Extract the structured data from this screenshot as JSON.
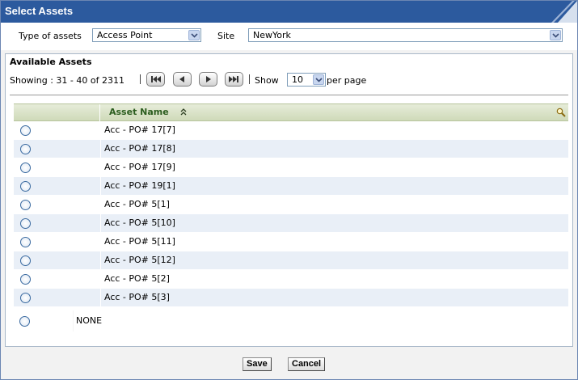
{
  "window": {
    "title": "Select Assets"
  },
  "filters": {
    "type_label": "Type of assets",
    "type_value": "Access Point",
    "site_label": "Site",
    "site_value": "NewYork"
  },
  "panel": {
    "title": "Available Assets",
    "showing": "Showing : 31 - 40 of 2311",
    "show_label": "Show",
    "page_size": "10",
    "per_page_label": "per page"
  },
  "grid": {
    "column_header": "Asset Name",
    "rows": [
      {
        "name": "Acc - PO# 17[7]"
      },
      {
        "name": "Acc - PO# 17[8]"
      },
      {
        "name": "Acc - PO# 17[9]"
      },
      {
        "name": "Acc - PO# 19[1]"
      },
      {
        "name": "Acc - PO# 5[1]"
      },
      {
        "name": "Acc - PO# 5[10]"
      },
      {
        "name": "Acc - PO# 5[11]"
      },
      {
        "name": "Acc - PO# 5[12]"
      },
      {
        "name": "Acc - PO# 5[2]"
      },
      {
        "name": "Acc - PO# 5[3]"
      }
    ],
    "none_label": "NONE"
  },
  "footer": {
    "save_label": "Save",
    "cancel_label": "Cancel"
  },
  "icons": {
    "first": "first-page-icon",
    "prev": "prev-page-icon",
    "next": "next-page-icon",
    "last": "last-page-icon",
    "sort": "sort-ascending-icon",
    "search": "search-icon",
    "dropdown": "chevron-down-icon"
  },
  "colors": {
    "titlebar": "#2c5a9e",
    "header_text": "#2c5d1f",
    "alt_row": "#e9eff7"
  }
}
